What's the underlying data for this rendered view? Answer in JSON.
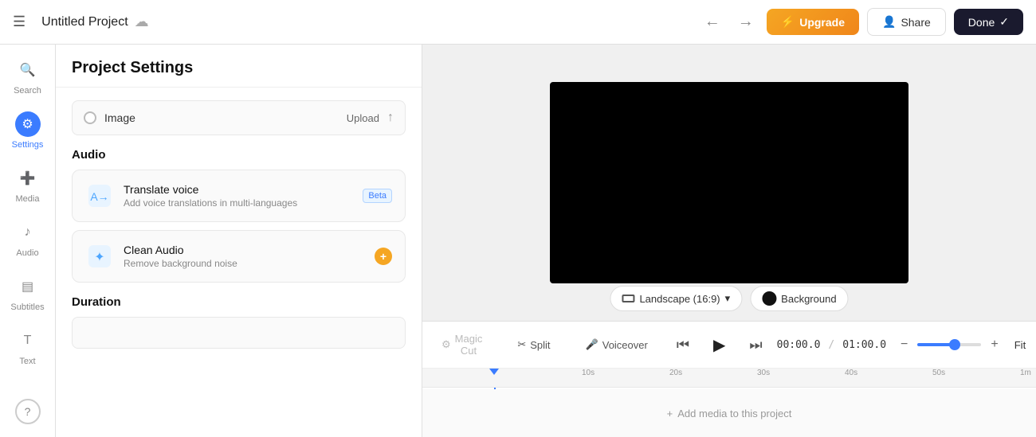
{
  "topbar": {
    "menu_icon": "☰",
    "title": "Untitled Project",
    "cloud_icon": "☁",
    "back_icon": "←",
    "forward_icon": "→",
    "upgrade_label": "Upgrade",
    "upgrade_icon": "⚡",
    "share_label": "Share",
    "share_icon": "👤",
    "done_label": "Done",
    "done_icon": "✓"
  },
  "sidebar": {
    "items": [
      {
        "id": "search",
        "icon": "🔍",
        "label": "Search",
        "active": false
      },
      {
        "id": "settings",
        "icon": "⚙",
        "label": "Settings",
        "active": true
      },
      {
        "id": "media",
        "icon": "➕",
        "label": "Media",
        "active": false
      },
      {
        "id": "audio",
        "icon": "♪",
        "label": "Audio",
        "active": false
      },
      {
        "id": "subtitles",
        "icon": "▤",
        "label": "Subtitles",
        "active": false
      },
      {
        "id": "text",
        "icon": "T",
        "label": "Text",
        "active": false
      }
    ],
    "help_icon": "?"
  },
  "settings_panel": {
    "title": "Project Settings",
    "image": {
      "label": "Image",
      "upload_btn": "Upload",
      "upload_icon": "↑"
    },
    "audio_section": {
      "title": "Audio",
      "features": [
        {
          "id": "translate-voice",
          "icon": "🔤",
          "name": "Translate voice",
          "desc": "Add voice translations in multi-languages",
          "badge": "Beta",
          "badge_type": "beta"
        },
        {
          "id": "clean-audio",
          "icon": "✦",
          "name": "Clean Audio",
          "desc": "Remove background noise",
          "badge": "+",
          "badge_type": "upgrade"
        }
      ]
    },
    "duration_section": {
      "title": "Duration"
    }
  },
  "preview": {
    "landscape_label": "Landscape (16:9)",
    "landscape_chevron": "▾",
    "background_label": "Background"
  },
  "timeline": {
    "magic_cut_label": "Magic Cut",
    "split_label": "Split",
    "voiceover_label": "Voiceover",
    "rewind_icon": "⏮",
    "play_icon": "▶",
    "fast_forward_icon": "⏭",
    "current_time": "00:00.0",
    "total_time": "01:00.0",
    "fit_label": "Fit",
    "zoom_percent": 60,
    "ruler_marks": [
      "10s",
      "20s",
      "30s",
      "40s",
      "50s",
      "1m"
    ],
    "ruler_positions": [
      200,
      310,
      420,
      530,
      640,
      750
    ],
    "add_media_label": "Add media to this project",
    "add_media_icon": "+"
  }
}
